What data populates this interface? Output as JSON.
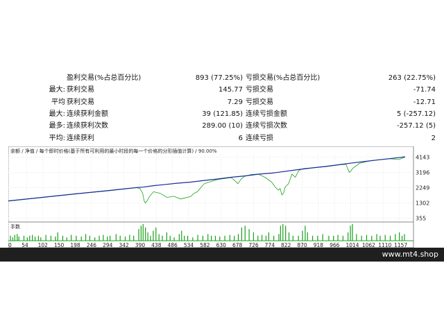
{
  "stats": [
    {
      "l1": "",
      "l2": "盈利交易(%占总百分比)",
      "v1": "893 (77.25%)",
      "l3": "亏损交易(%占总百分比)",
      "v2": "263 (22.75%)"
    },
    {
      "l1": "最大:",
      "l2": "获利交易",
      "v1": "145.77",
      "l3": "亏损交易",
      "v2": "-71.74"
    },
    {
      "l1": "平均",
      "l2": "获利交易",
      "v1": "7.29",
      "l3": "亏损交易",
      "v2": "-12.71"
    },
    {
      "l1": "最大:",
      "l2": "连续获利金额",
      "v1": "39 (121.85)",
      "l3": "连续亏损金额",
      "v2": "5 (-257.12)"
    },
    {
      "l1": "最多:",
      "l2": "连续获利次数",
      "v1": "289.00 (10)",
      "l3": "连续亏损次数",
      "v2": "-257.12 (5)"
    },
    {
      "l1": "平均:",
      "l2": "连续获利",
      "v1": "6",
      "l3": "连续亏损",
      "v2": "2"
    }
  ],
  "chart_data": {
    "type": "line",
    "title": "余额 / 净值 / 每个即时价格(基于所有可利用的最小时段的每一个价格的分形插值计算) / 90.00%",
    "legend": [
      "余额",
      "净值"
    ],
    "x_ticks": [
      0,
      54,
      102,
      150,
      198,
      246,
      294,
      342,
      390,
      438,
      486,
      534,
      582,
      630,
      678,
      726,
      774,
      822,
      870,
      918,
      966,
      1014,
      1062,
      1110,
      1157
    ],
    "y_ticks": [
      4143,
      3196,
      2249,
      1302,
      355
    ],
    "xlim": [
      0,
      1200
    ],
    "ylim": [
      250,
      4300
    ],
    "volume_label": "手数",
    "colors": {
      "balance": "#1a2a9a",
      "equity": "#18a018",
      "volume": "#18a018"
    },
    "balance": {
      "x": [
        0,
        100,
        200,
        300,
        380,
        400,
        430,
        460,
        500,
        540,
        580,
        620,
        660,
        700,
        740,
        780,
        800,
        860,
        900,
        940,
        980,
        1020,
        1060,
        1100,
        1157,
        1175
      ],
      "y": [
        1430,
        1650,
        1870,
        2080,
        2260,
        2290,
        2380,
        2440,
        2530,
        2600,
        2700,
        2790,
        2900,
        2980,
        3090,
        3160,
        3210,
        3380,
        3480,
        3570,
        3680,
        3790,
        3890,
        3990,
        4120,
        4170
      ]
    },
    "equity": {
      "x": [
        0,
        100,
        200,
        300,
        380,
        390,
        398,
        402,
        406,
        412,
        418,
        430,
        450,
        470,
        490,
        510,
        520,
        540,
        550,
        560,
        580,
        620,
        660,
        670,
        680,
        690,
        700,
        720,
        740,
        760,
        780,
        790,
        800,
        805,
        810,
        815,
        820,
        830,
        840,
        850,
        860,
        870,
        880,
        900,
        940,
        980,
        1000,
        1010,
        1015,
        1020,
        1040,
        1060,
        1080,
        1100,
        1130,
        1150,
        1157,
        1175
      ],
      "y": [
        1420,
        1640,
        1860,
        2070,
        2250,
        2200,
        1900,
        1450,
        1300,
        1460,
        1700,
        2000,
        1900,
        1650,
        1720,
        1550,
        1600,
        1700,
        1900,
        2000,
        2500,
        2760,
        2880,
        2700,
        2500,
        2800,
        2960,
        3070,
        3100,
        2900,
        2600,
        2300,
        2100,
        2200,
        1800,
        1900,
        2300,
        2500,
        3100,
        2900,
        3300,
        3420,
        3450,
        3480,
        3560,
        3670,
        3700,
        3200,
        3300,
        3450,
        3760,
        3870,
        3950,
        3980,
        4050,
        4020,
        4000,
        4150
      ]
    },
    "volume": {
      "x": [
        5,
        12,
        18,
        25,
        30,
        45,
        55,
        62,
        70,
        78,
        88,
        95,
        110,
        125,
        138,
        145,
        160,
        172,
        185,
        200,
        215,
        228,
        240,
        255,
        268,
        280,
        292,
        300,
        318,
        330,
        345,
        358,
        370,
        385,
        392,
        398,
        405,
        412,
        420,
        428,
        436,
        445,
        455,
        468,
        478,
        490,
        505,
        512,
        520,
        530,
        545,
        560,
        575,
        590,
        600,
        612,
        625,
        640,
        655,
        668,
        680,
        690,
        700,
        712,
        725,
        738,
        750,
        762,
        770,
        785,
        800,
        805,
        812,
        820,
        830,
        842,
        858,
        870,
        878,
        885,
        900,
        915,
        930,
        948,
        962,
        975,
        990,
        1005,
        1012,
        1018,
        1030,
        1045,
        1060,
        1075,
        1090,
        1100,
        1115,
        1130,
        1145,
        1157,
        1165,
        1172
      ],
      "y": [
        0.3,
        0.2,
        0.35,
        0.4,
        0.25,
        0.3,
        0.2,
        0.3,
        0.35,
        0.25,
        0.3,
        0.2,
        0.35,
        0.3,
        0.25,
        0.5,
        0.3,
        0.2,
        0.35,
        0.3,
        0.25,
        0.4,
        0.3,
        0.2,
        0.3,
        0.35,
        0.25,
        0.3,
        0.4,
        0.3,
        0.25,
        0.35,
        0.3,
        0.7,
        0.9,
        1.0,
        0.8,
        0.5,
        0.3,
        0.6,
        0.8,
        0.4,
        0.3,
        0.5,
        0.3,
        0.2,
        0.4,
        0.6,
        0.3,
        0.3,
        0.2,
        0.35,
        0.3,
        0.4,
        0.3,
        0.3,
        0.25,
        0.3,
        0.35,
        0.3,
        0.4,
        0.8,
        0.9,
        0.7,
        0.5,
        0.3,
        0.35,
        0.3,
        0.5,
        0.3,
        0.4,
        0.9,
        1.0,
        0.9,
        0.5,
        0.3,
        0.3,
        0.6,
        0.9,
        0.5,
        0.3,
        0.3,
        0.4,
        0.3,
        0.3,
        0.35,
        0.3,
        0.5,
        0.9,
        1.0,
        0.4,
        0.3,
        0.35,
        0.3,
        0.4,
        0.3,
        0.35,
        0.3,
        0.4,
        0.5,
        0.3,
        0.4
      ]
    }
  },
  "footer": {
    "watermark": "www.mt4.shop"
  }
}
